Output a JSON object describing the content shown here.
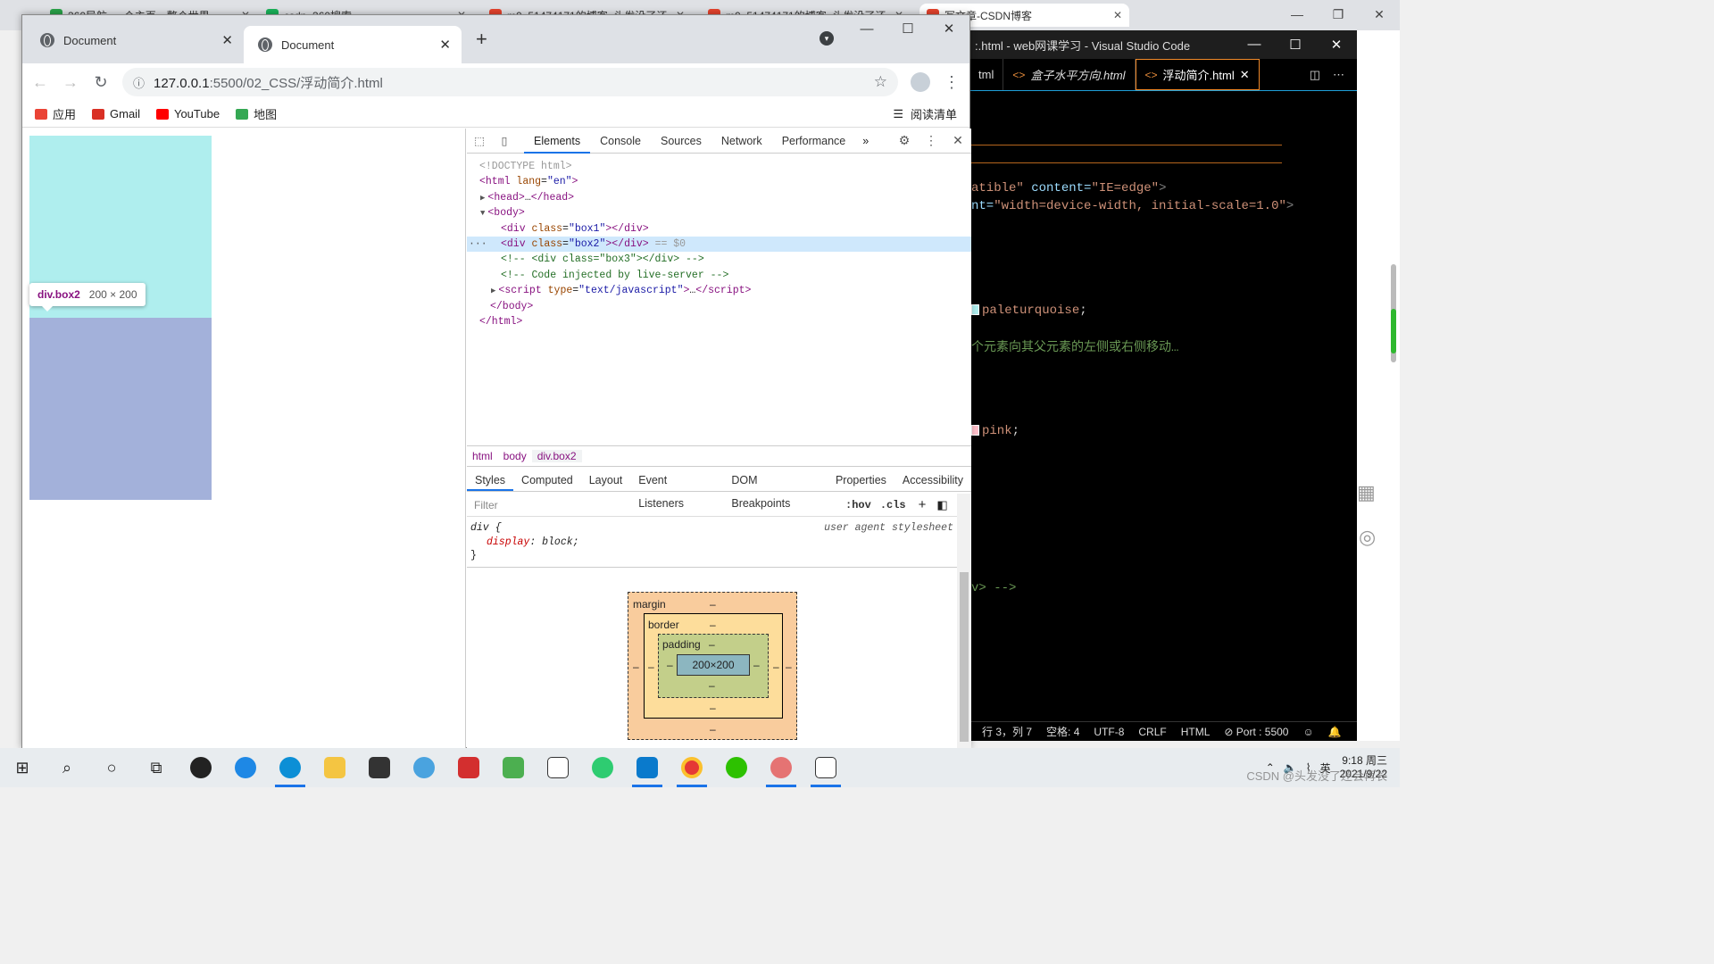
{
  "background_tabs": [
    {
      "title": "360导航_一个主页，整个世界",
      "color": "#2aa34a"
    },
    {
      "title": "csdn_360搜索",
      "color": "#1ab35a"
    },
    {
      "title": "m0_51474171的博客_头发没了还",
      "color": "#e5432d"
    },
    {
      "title": "m0_51474171的博客_头发没了还",
      "color": "#e5432d"
    },
    {
      "title": "写文章-CSDN博客",
      "color": "#e5432d"
    }
  ],
  "vscode": {
    "title": ":.html - web网课学习 - Visual Studio Code",
    "tabs": [
      {
        "label": "tml"
      },
      {
        "label": "盒子水平方向.html",
        "italic": true
      },
      {
        "label": "浮动简介.html",
        "active": true
      }
    ],
    "code_lines": [
      {
        "parts": [
          {
            "t": "atible\"",
            "c": "#ce9178"
          },
          {
            "t": " content=",
            "c": "#9cdcfe"
          },
          {
            "t": "\"IE=edge\"",
            "c": "#ce9178"
          },
          {
            "t": ">",
            "c": "#808080"
          }
        ]
      },
      {
        "parts": [
          {
            "t": "nt=",
            "c": "#9cdcfe"
          },
          {
            "t": "\"width=device-width, initial-scale=1.0\"",
            "c": "#ce9178"
          },
          {
            "t": ">",
            "c": "#808080"
          }
        ]
      },
      {
        "parts": [
          {
            "t": "paleturquoise",
            "c": "#ce9178"
          },
          {
            "t": ";",
            "c": "#d4d4d4"
          }
        ],
        "swatch": "#afeeee"
      },
      {
        "parts": [
          {
            "t": "个元素向其父元素的左侧或右侧移动…",
            "c": "#6a9955"
          }
        ]
      },
      {
        "parts": [
          {
            "t": "pink",
            "c": "#ce9178"
          },
          {
            "t": ";",
            "c": "#d4d4d4"
          }
        ],
        "swatch": "#ffc0cb"
      },
      {
        "parts": [
          {
            "t": "v> -->",
            "c": "#6a9955"
          }
        ]
      }
    ],
    "status": [
      "行 3，列 7",
      "空格: 4",
      "UTF-8",
      "CRLF",
      "HTML",
      "⊘ Port : 5500"
    ]
  },
  "chrome": {
    "tabs": [
      {
        "title": "Document"
      },
      {
        "title": "Document",
        "active": true
      }
    ],
    "url_host": "127.0.0.1",
    "url_path": ":5500/02_CSS/浮动简介.html",
    "bookmarks": [
      {
        "label": "应用",
        "icon": "apps-icon"
      },
      {
        "label": "Gmail",
        "icon": "gmail-icon"
      },
      {
        "label": "YouTube",
        "icon": "youtube-icon"
      },
      {
        "label": "地图",
        "icon": "maps-icon"
      }
    ],
    "reading_list": "阅读清单"
  },
  "page": {
    "box1_color": "#afeeee",
    "box2_color": "#a3b1da",
    "tooltip_tag": "div.box2",
    "tooltip_size": "200 × 200"
  },
  "devtools": {
    "tabs": [
      "Elements",
      "Console",
      "Sources",
      "Network",
      "Performance"
    ],
    "dom": [
      {
        "indent": 0,
        "html": "<span class='gr'>&lt;!DOCTYPE html&gt;</span>"
      },
      {
        "indent": 0,
        "html": "<span class='tg'>&lt;html</span> <span class='at'>lang</span>=<span class='av'>\"en\"</span><span class='tg'>&gt;</span>"
      },
      {
        "indent": 1,
        "arrow": "▶",
        "html": "<span class='tg'>&lt;head&gt;</span>…<span class='tg'>&lt;/head&gt;</span>"
      },
      {
        "indent": 1,
        "arrow": "▼",
        "html": "<span class='tg'>&lt;body&gt;</span>"
      },
      {
        "indent": 2,
        "html": "<span class='tg'>&lt;div</span> <span class='at'>class</span>=<span class='av'>\"box1\"</span><span class='tg'>&gt;&lt;/div&gt;</span>"
      },
      {
        "indent": 2,
        "sel": true,
        "html": "<span class='tg'>&lt;div</span> <span class='at'>class</span>=<span class='av'>\"box2\"</span><span class='tg'>&gt;&lt;/div&gt;</span> <span class='gr'>== $0</span>"
      },
      {
        "indent": 2,
        "html": "<span class='cm'>&lt;!-- &lt;div class=\"box3\"&gt;&lt;/div&gt; --&gt;</span>"
      },
      {
        "indent": 2,
        "html": "<span class='cm'>&lt;!-- Code injected by live-server --&gt;</span>"
      },
      {
        "indent": 2,
        "arrow": "▶",
        "html": "<span class='tg'>&lt;script</span> <span class='at'>type</span>=<span class='av'>\"text/javascript\"</span><span class='tg'>&gt;</span>…<span class='tg'>&lt;/script&gt;</span>"
      },
      {
        "indent": 1,
        "html": "<span class='tg'>&lt;/body&gt;</span>"
      },
      {
        "indent": 0,
        "html": "<span class='tg'>&lt;/html&gt;</span>"
      }
    ],
    "breadcrumbs": [
      "html",
      "body",
      "div.box2"
    ],
    "styles_tabs": [
      "Styles",
      "Computed",
      "Layout",
      "Event Listeners",
      "DOM Breakpoints",
      "Properties",
      "Accessibility"
    ],
    "filter_placeholder": "Filter",
    "hov": ":hov",
    "cls": ".cls",
    "rule_selector": "div {",
    "rule_prop": "display",
    "rule_value": "block;",
    "rule_close": "}",
    "rule_source": "user agent stylesheet",
    "boxmodel": {
      "margin": "margin",
      "border": "border",
      "padding": "padding",
      "content": "200×200",
      "dash": "–"
    }
  },
  "taskbar": {
    "time": "9:18 周三",
    "date": "2021/9/22",
    "watermark": "CSDN @头发没了还会再长",
    "ime": "英"
  }
}
